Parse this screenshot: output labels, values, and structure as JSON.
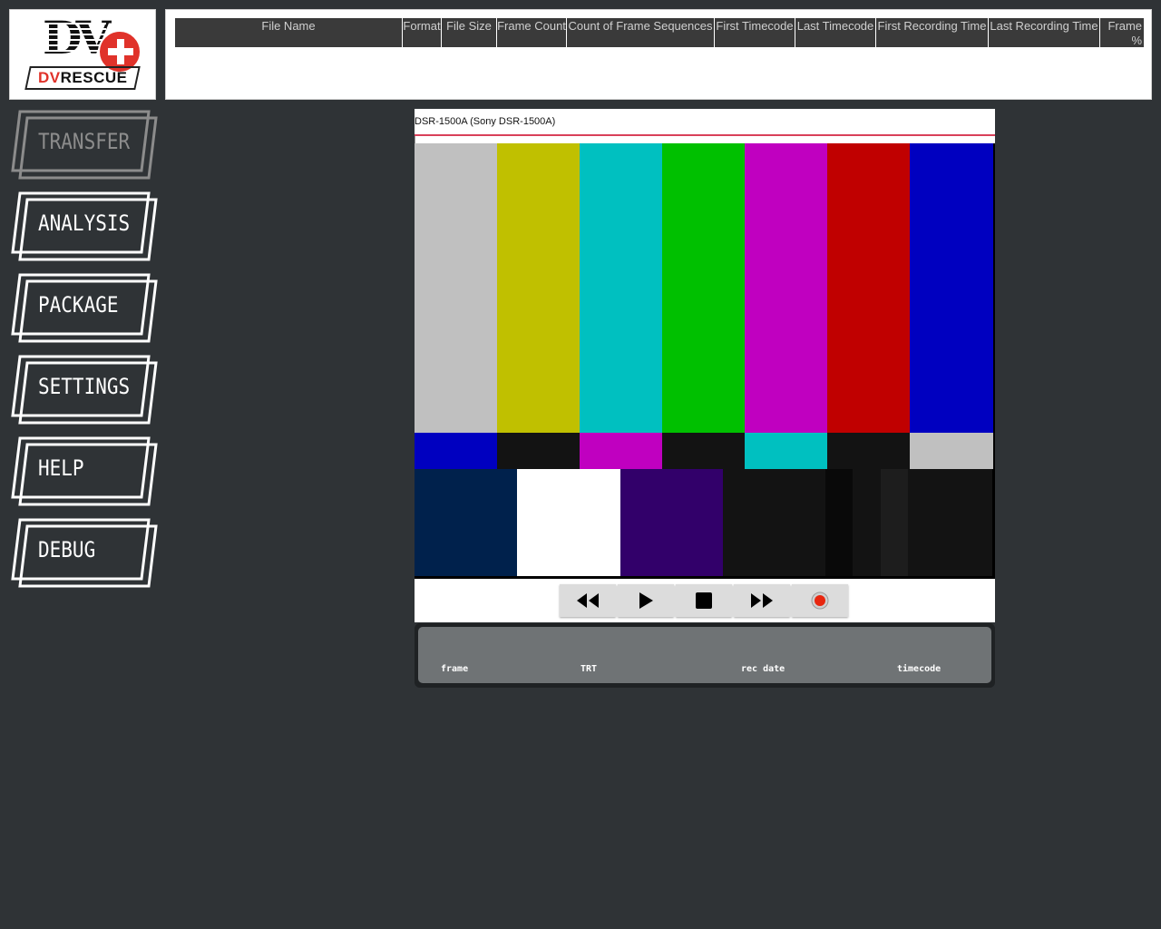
{
  "logo": {
    "mark": "DV",
    "word_part1": "DV",
    "word_part2": "RESCUE",
    "brand_red": "#e0322a"
  },
  "file_table": {
    "columns": [
      "File Name",
      "Format",
      "File Size",
      "Frame Count",
      "Count of Frame Sequences",
      "First Timecode",
      "Last Timecode",
      "First Recording Time",
      "Last Recording Time",
      "Frame %"
    ],
    "rows": []
  },
  "nav": {
    "transfer": "TRANSFER",
    "analysis": "ANALYSIS",
    "package": "PACKAGE",
    "settings": "SETTINGS",
    "help": "HELP",
    "debug": "DEBUG",
    "active": "transfer"
  },
  "device": {
    "name": "DSR-1500A (Sony DSR-1500A)",
    "accent": "#d9405a"
  },
  "preview": {
    "pattern": "smpte-color-bars",
    "top_colors": [
      "#c0c0c0",
      "#c0c000",
      "#00c0c0",
      "#00c000",
      "#c000c0",
      "#c00000",
      "#0000c0"
    ],
    "mid_colors": [
      "#0000c0",
      "#131313",
      "#c000c0",
      "#131313",
      "#00c0c0",
      "#131313",
      "#c0c0c0"
    ],
    "bottom_colors": [
      "#00214c",
      "#ffffff",
      "#32006a",
      "#131313",
      "#090909",
      "#131313",
      "#1d1d1d",
      "#131313"
    ]
  },
  "transport": {
    "buttons": [
      "rewind-icon",
      "play-icon",
      "stop-icon",
      "fast-forward-icon",
      "record-icon"
    ],
    "record_color": "#e8260f"
  },
  "status": {
    "frame_label": "frame",
    "trt_label": "TRT",
    "rec_date_label": "rec date",
    "timecode_label": "timecode"
  }
}
